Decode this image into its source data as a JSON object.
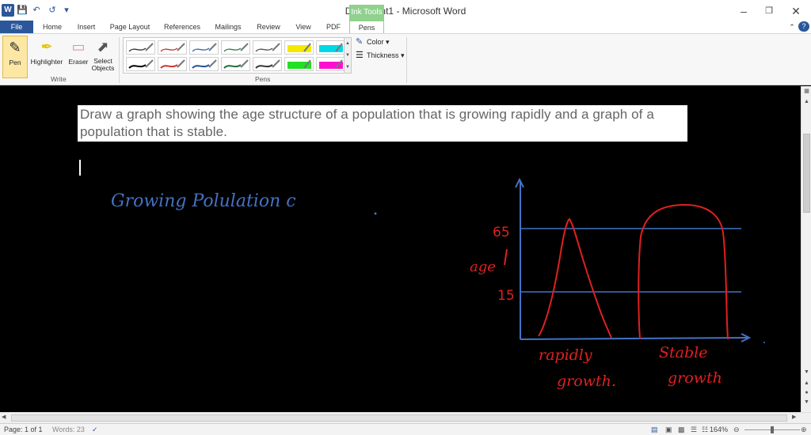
{
  "window": {
    "title_doc": "Document1",
    "title_sep": " - ",
    "title_app": "Microsoft Word",
    "contextual_tab_group": "Ink Tools"
  },
  "quick_access": {
    "word_icon": "W"
  },
  "tabs": [
    "File",
    "Home",
    "Insert",
    "Page Layout",
    "References",
    "Mailings",
    "Review",
    "View",
    "PDF",
    "Pens"
  ],
  "ribbon": {
    "write_group": {
      "label": "Write",
      "buttons": {
        "pen": "Pen",
        "highlighter": "Highlighter",
        "eraser": "Eraser",
        "select": "Select Objects"
      }
    },
    "pens_group": {
      "label": "Pens"
    },
    "color_label": "Color",
    "thickness_label": "Thickness"
  },
  "document": {
    "question": "Draw a graph showing the age structure of a population that is growing rapidly and a graph of a population that is stable.",
    "ink": {
      "heading": "Growing  Polulation  c",
      "ylabel": "age",
      "tick_65": "65",
      "tick_15": "15",
      "label_rapid_1": "rapidly",
      "label_rapid_2": "growth.",
      "label_stable_1": "Stable",
      "label_stable_2": "growth"
    }
  },
  "status": {
    "page": "Page: 1 of 1",
    "words": "Words: 23",
    "zoom": "164%"
  },
  "colors": {
    "accent": "#2b579a",
    "ink_tools": "#8fd18d",
    "ink_blue": "#4472c4",
    "ink_red": "#e02020"
  }
}
